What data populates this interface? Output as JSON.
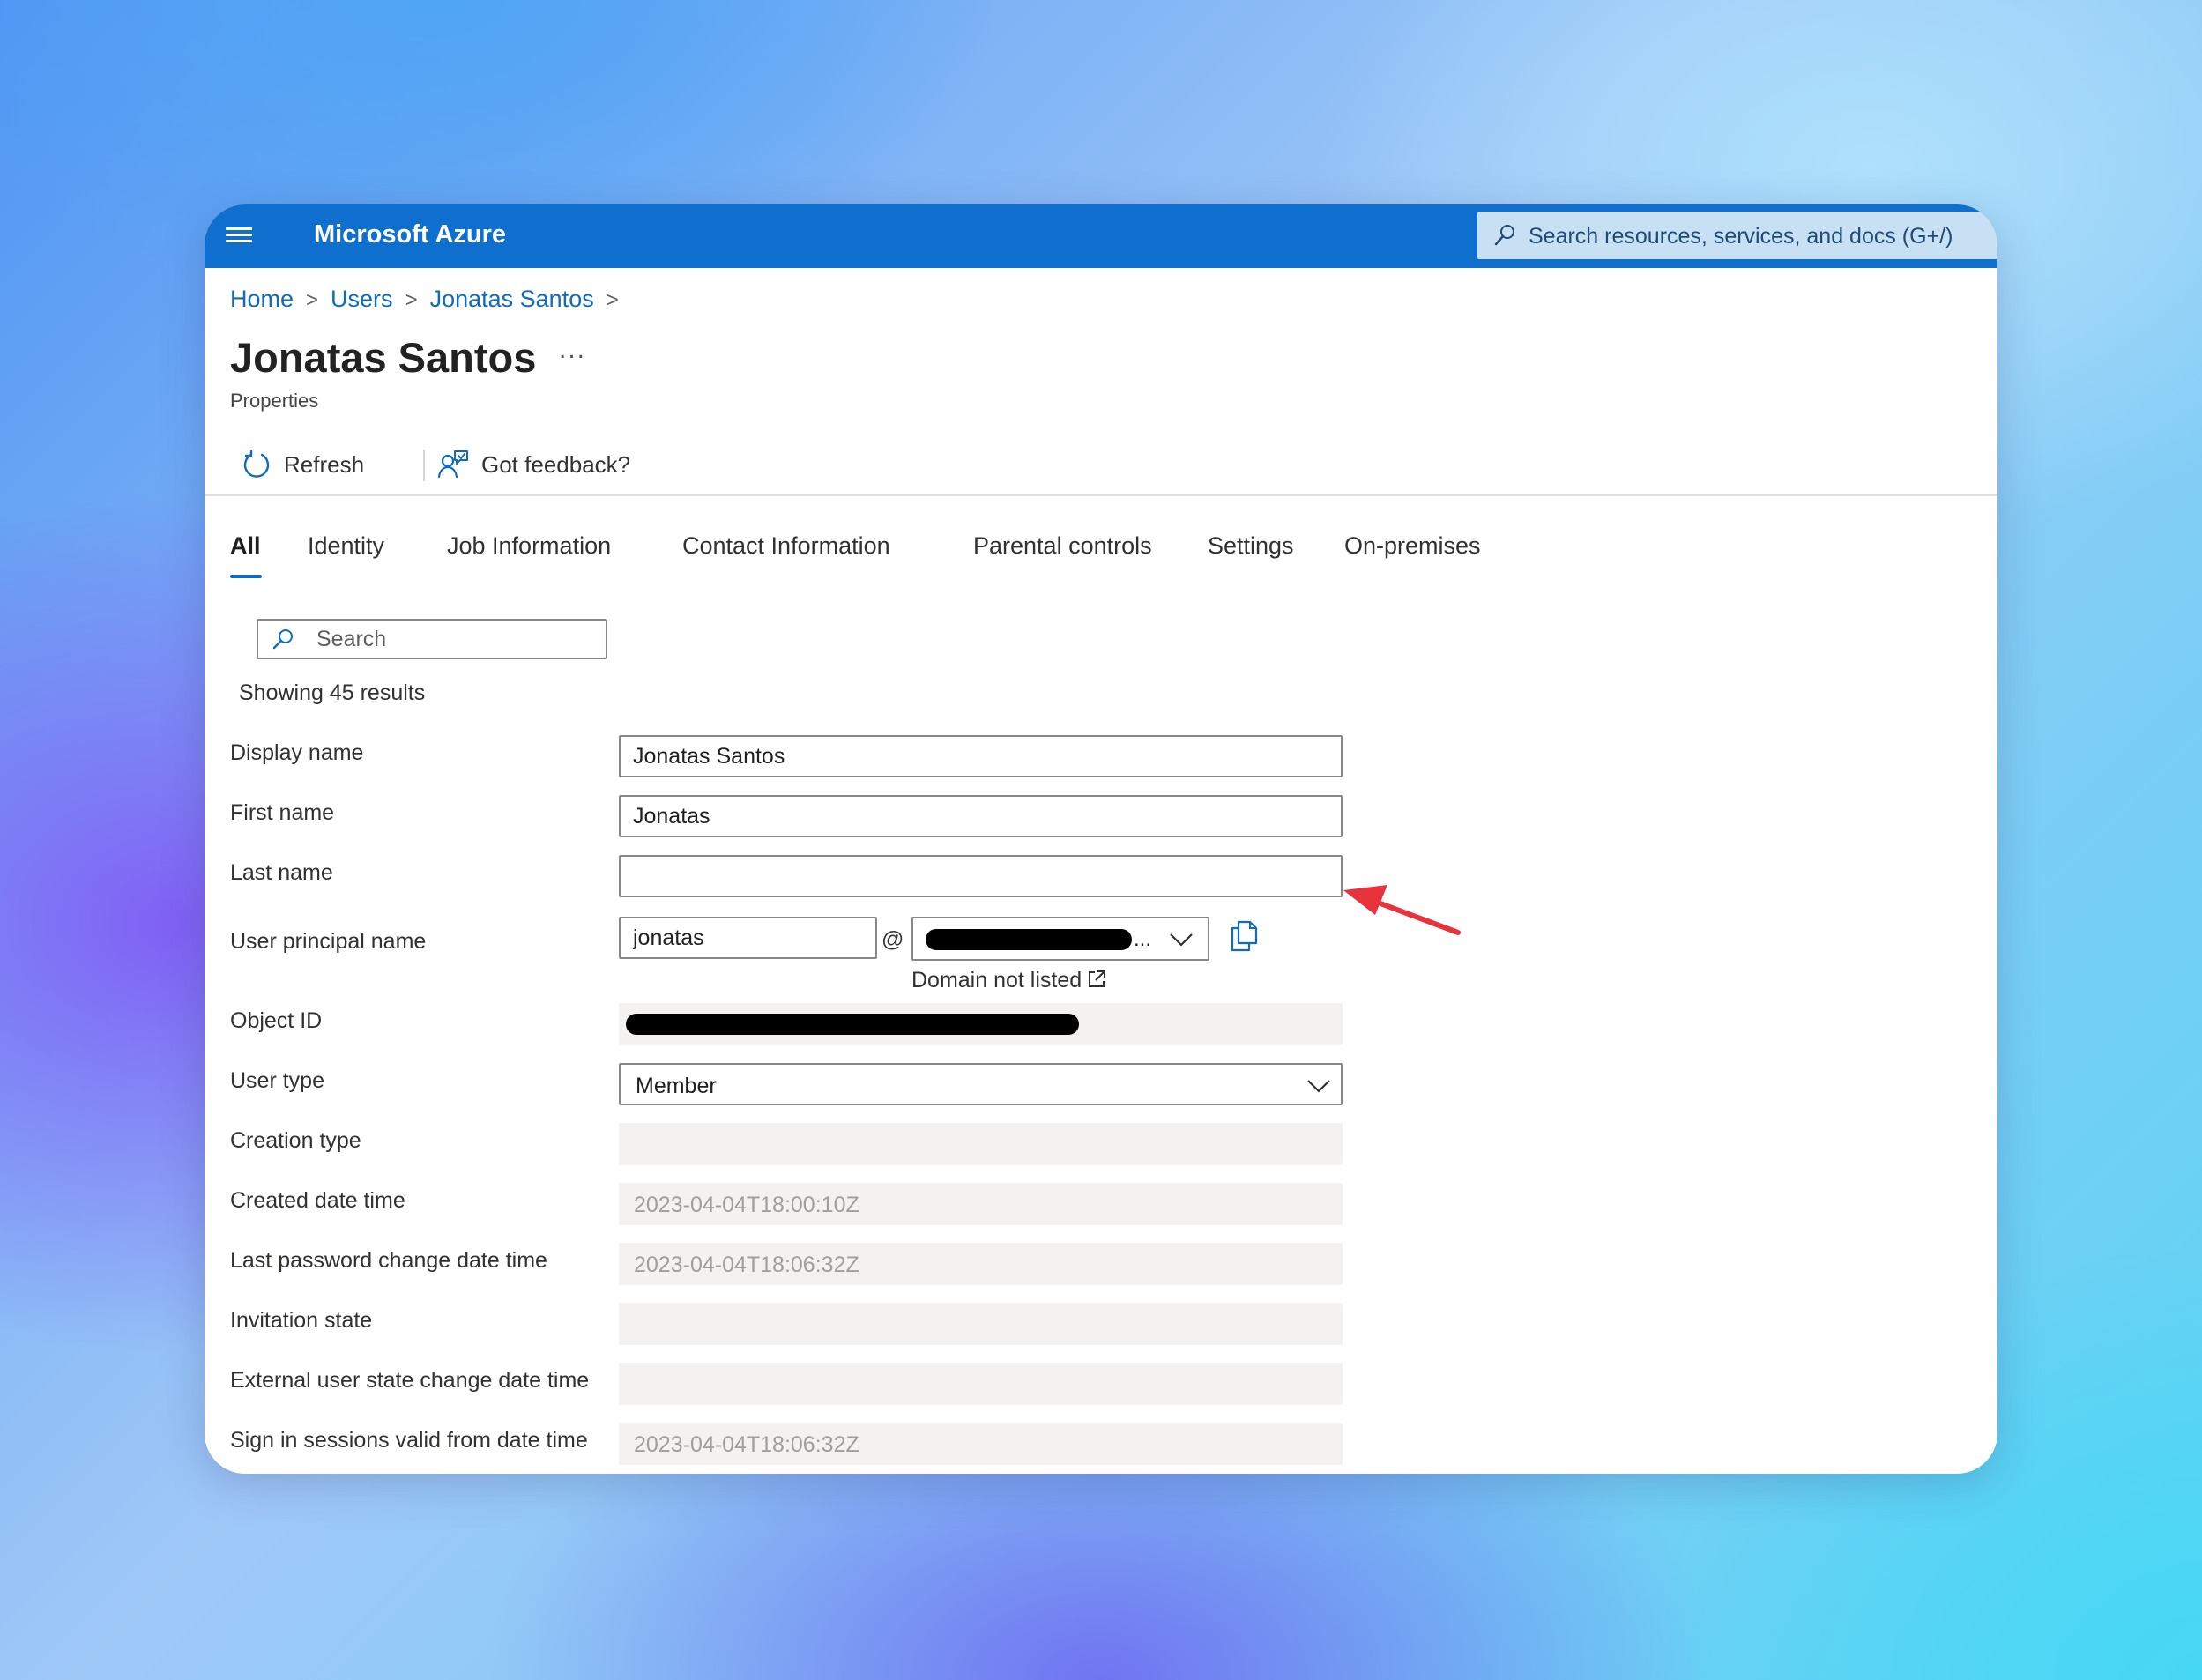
{
  "header": {
    "brand": "Microsoft Azure",
    "search_placeholder": "Search resources, services, and docs (G+/)",
    "accent_color": "#0f6fce"
  },
  "breadcrumb": [
    "Home",
    "Users",
    "Jonatas Santos"
  ],
  "page": {
    "title": "Jonatas Santos",
    "more_label": "...",
    "subtitle": "Properties"
  },
  "toolbar": {
    "refresh_label": "Refresh",
    "feedback_label": "Got feedback?"
  },
  "tabs": [
    "All",
    "Identity",
    "Job Information",
    "Contact Information",
    "Parental controls",
    "Settings",
    "On-premises"
  ],
  "active_tab": "All",
  "search": {
    "placeholder": "Search",
    "results_text": "Showing 45 results"
  },
  "fields": {
    "display_name": {
      "label": "Display name",
      "value": "Jonatas Santos"
    },
    "first_name": {
      "label": "First name",
      "value": "Jonatas"
    },
    "last_name": {
      "label": "Last name",
      "value": ""
    },
    "user_principal_name": {
      "label": "User principal name",
      "value": "jonatas",
      "at": "@",
      "domain_ellipsis": "...",
      "domain_link": "Domain not listed"
    },
    "object_id": {
      "label": "Object ID"
    },
    "user_type": {
      "label": "User type",
      "value": "Member"
    },
    "creation_type": {
      "label": "Creation type",
      "value": ""
    },
    "created_date_time": {
      "label": "Created date time",
      "value": "2023-04-04T18:00:10Z"
    },
    "last_password_change": {
      "label": "Last password change date time",
      "value": "2023-04-04T18:06:32Z"
    },
    "invitation_state": {
      "label": "Invitation state",
      "value": ""
    },
    "external_user_state_change": {
      "label": "External user state change date time",
      "value": ""
    },
    "sign_in_sessions_valid_from": {
      "label": "Sign in sessions valid from date time",
      "value": "2023-04-04T18:06:32Z"
    }
  },
  "icons": [
    "hamburger-icon",
    "search-icon",
    "refresh-icon",
    "feedback-icon",
    "chevron-down-icon",
    "copy-icon",
    "external-link-icon",
    "red-arrow-annotation"
  ],
  "annotation_color": "#e8323c"
}
